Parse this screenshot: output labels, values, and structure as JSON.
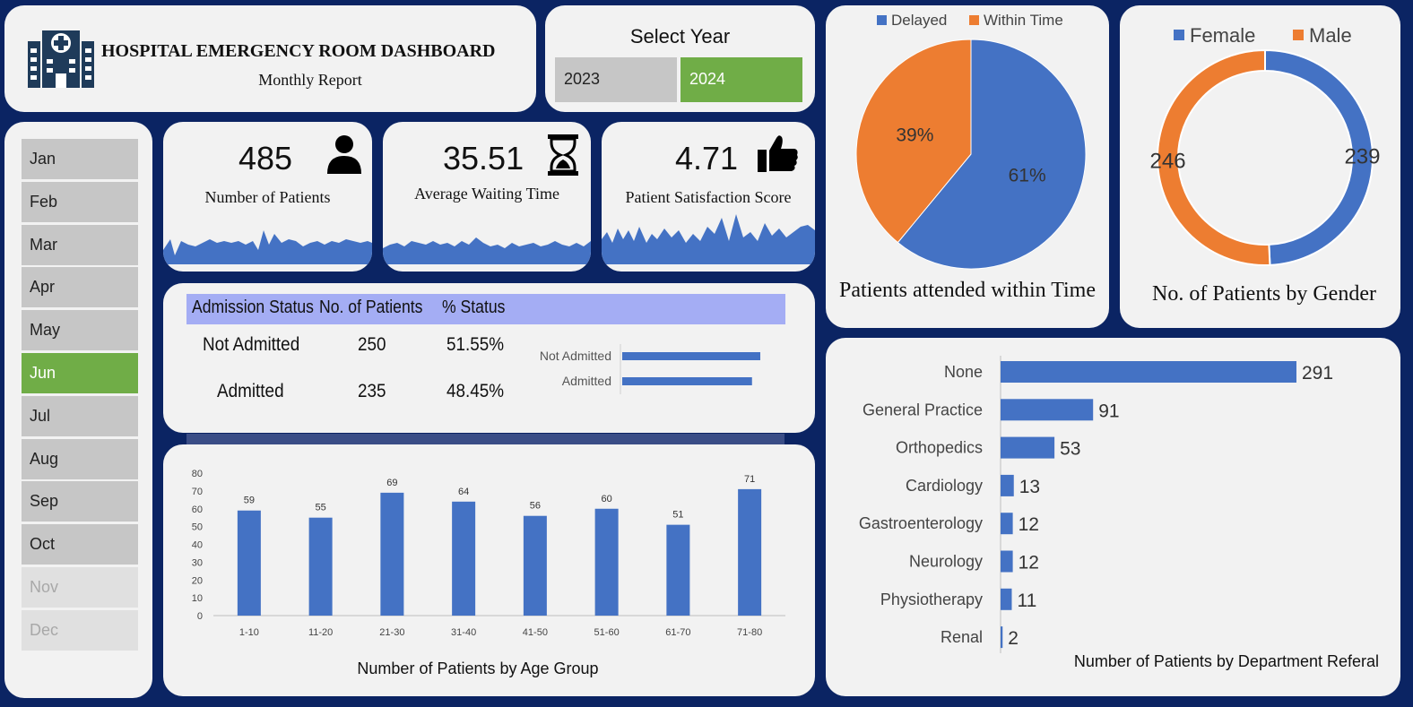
{
  "header": {
    "title": "HOSPITAL EMERGENCY ROOM DASHBOARD",
    "subtitle": "Monthly Report"
  },
  "year_selector": {
    "label": "Select Year",
    "options": [
      "2023",
      "2024"
    ],
    "selected": "2024"
  },
  "months": {
    "items": [
      {
        "label": "Jan",
        "state": "normal"
      },
      {
        "label": "Feb",
        "state": "normal"
      },
      {
        "label": "Mar",
        "state": "normal"
      },
      {
        "label": "Apr",
        "state": "normal"
      },
      {
        "label": "May",
        "state": "normal"
      },
      {
        "label": "Jun",
        "state": "active"
      },
      {
        "label": "Jul",
        "state": "normal"
      },
      {
        "label": "Aug",
        "state": "normal"
      },
      {
        "label": "Sep",
        "state": "normal"
      },
      {
        "label": "Oct",
        "state": "normal"
      },
      {
        "label": "Nov",
        "state": "disabled"
      },
      {
        "label": "Dec",
        "state": "disabled"
      }
    ]
  },
  "kpis": {
    "patients": {
      "value": "485",
      "label": "Number of Patients",
      "icon": "person-icon"
    },
    "waiting": {
      "value": "35.51",
      "label": "Average Waiting Time",
      "icon": "hourglass-icon"
    },
    "satisfaction": {
      "value": "4.71",
      "label": "Patient Satisfaction Score",
      "icon": "thumbs-up-icon"
    }
  },
  "colors": {
    "blue": "#4472c4",
    "orange": "#ed7d31",
    "green": "#70ad47",
    "header_band": "#a4adf4",
    "background": "#0b2463"
  },
  "admission": {
    "headers": [
      "Admission Status",
      "No. of Patients",
      "% Status"
    ],
    "rows": [
      {
        "status": "Not Admitted",
        "count": "250",
        "pct": "51.55%"
      },
      {
        "status": "Admitted",
        "count": "235",
        "pct": "48.45%"
      }
    ]
  },
  "chart_data": [
    {
      "type": "bar",
      "title": "Number of Patients by Age Group",
      "categories": [
        "1-10",
        "11-20",
        "21-30",
        "31-40",
        "41-50",
        "51-60",
        "61-70",
        "71-80"
      ],
      "values": [
        59,
        55,
        69,
        64,
        56,
        60,
        51,
        71
      ],
      "ylim": [
        0,
        80
      ],
      "yticks": [
        0,
        10,
        20,
        30,
        40,
        50,
        60,
        70,
        80
      ],
      "grid": false
    },
    {
      "type": "pie",
      "title": "Patients attended within Time",
      "labels": [
        "Delayed",
        "Within Time"
      ],
      "values": [
        61,
        39
      ],
      "value_labels": [
        "61%",
        "39%"
      ],
      "legend": "top"
    },
    {
      "type": "pie",
      "title": "No. of Patients by Gender",
      "labels": [
        "Female",
        "Male"
      ],
      "values": [
        239,
        246
      ],
      "legend": "top",
      "style": "donut"
    },
    {
      "type": "bar",
      "orientation": "horizontal",
      "title": "Number of Patients by Department Referal",
      "categories": [
        "None",
        "General Practice",
        "Orthopedics",
        "Cardiology",
        "Gastroenterology",
        "Neurology",
        "Physiotherapy",
        "Renal"
      ],
      "values": [
        291,
        91,
        53,
        13,
        12,
        12,
        11,
        2
      ]
    },
    {
      "type": "bar",
      "orientation": "horizontal",
      "categories": [
        "Not Admitted",
        "Admitted"
      ],
      "values": [
        250,
        235
      ]
    }
  ]
}
